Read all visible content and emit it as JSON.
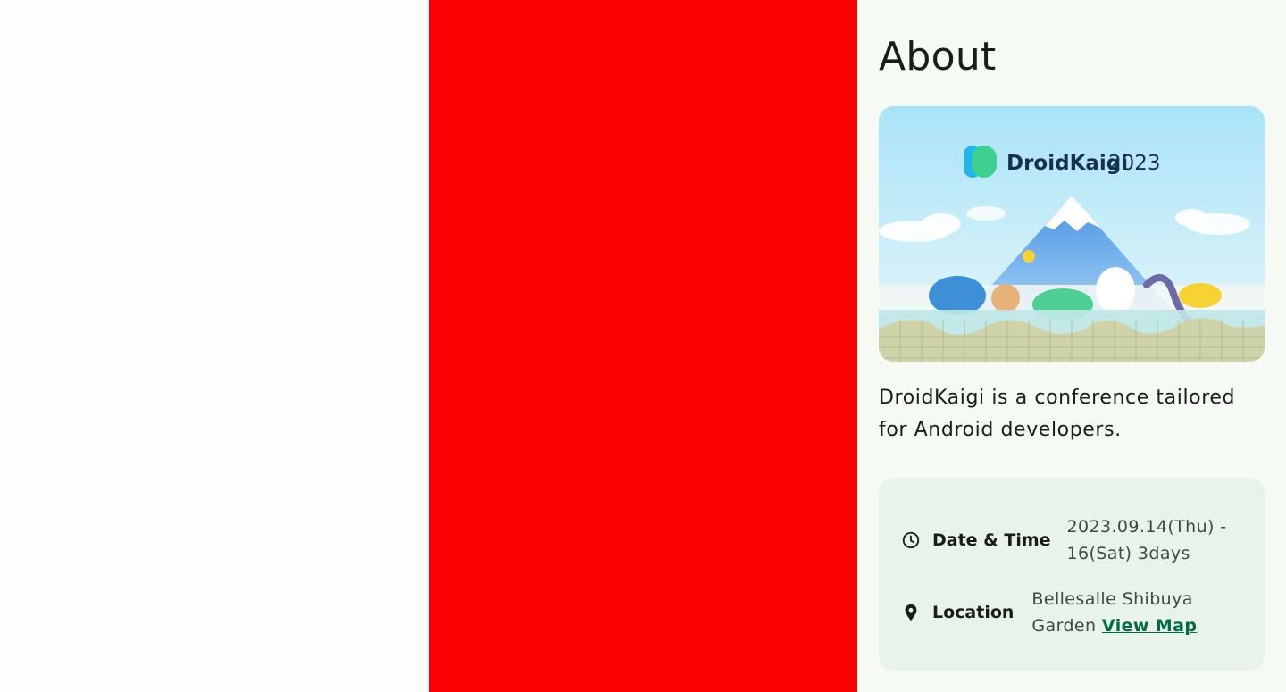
{
  "about": {
    "title": "About",
    "banner": {
      "logo_text": "DroidKaigi",
      "logo_year": "2023"
    },
    "description": "DroidKaigi is a conference tailored for Android developers.",
    "date_time": {
      "label": "Date & Time",
      "icon": "clock-icon",
      "value_line1": "2023.09.14(Thu) -",
      "value_line2": "16(Sat) 3days"
    },
    "location": {
      "label": "Location",
      "icon": "map-pin-icon",
      "value_line1": "Bellesalle Shibuya",
      "value_line2": "Garden",
      "link_text": "View Map"
    }
  },
  "colors": {
    "middle_pane": "#fb0000",
    "right_pane": "#f6faf5",
    "card": "#e8f3ec",
    "link": "#006c45"
  }
}
